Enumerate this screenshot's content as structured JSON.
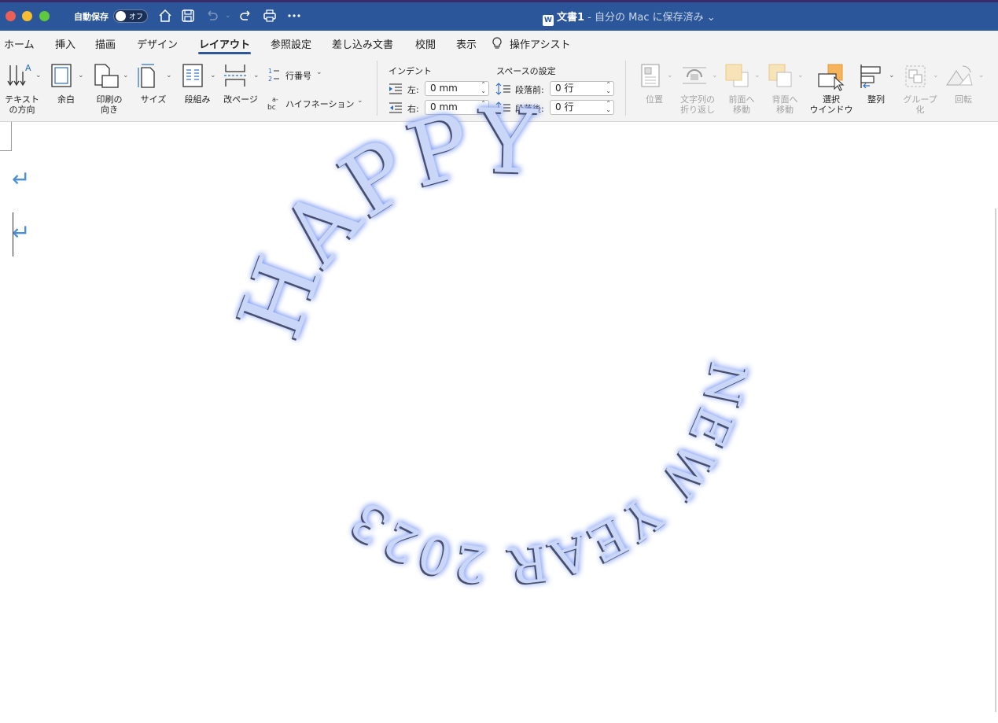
{
  "titlebar": {
    "autosave_label": "自動保存",
    "autosave_state": "オフ",
    "doc_name": "文書1",
    "doc_status": " - 自分の Mac に保存済み",
    "app_badge": "W",
    "colors": {
      "bar": "#2b579a",
      "close": "#ec5f57",
      "minimize": "#f5bd2f",
      "zoom": "#5fc83f"
    }
  },
  "tabs": [
    "ホーム",
    "挿入",
    "描画",
    "デザイン",
    "レイアウト",
    "参照設定",
    "差し込み文書",
    "校閲",
    "表示",
    "操作アシスト"
  ],
  "active_tab": "レイアウト",
  "ribbon": {
    "text_direction_line1": "テキスト",
    "text_direction_line2": "の方向",
    "margins": "余白",
    "orientation_line1": "印刷の",
    "orientation_line2": "向き",
    "size": "サイズ",
    "columns": "段組み",
    "breaks": "改ページ",
    "line_numbers": "行番号",
    "hyphenation": "ハイフネーション",
    "indent_title": "インデント",
    "indent_left_label": "左:",
    "indent_left_value": "0 mm",
    "indent_right_label": "右:",
    "indent_right_value": "0 mm",
    "spacing_title": "スペースの設定",
    "spacing_before_label": "段落前:",
    "spacing_before_value": "0 行",
    "spacing_after_label": "段落後:",
    "spacing_after_value": "0 行",
    "position": "位置",
    "wrap_line1": "文字列の",
    "wrap_line2": "折り返し",
    "bring_forward_line1": "前面へ",
    "bring_forward_line2": "移動",
    "send_backward_line1": "背面へ",
    "send_backward_line2": "移動",
    "selection_pane_line1": "選択",
    "selection_pane_line2": "ウインドウ",
    "align": "整列",
    "group_line1": "グループ",
    "group_line2": "化",
    "rotate": "回転"
  },
  "document": {
    "paragraph_mark": "↵",
    "wordart_top": "HAPPY",
    "wordart_bottom": "NEW YEAR 2023",
    "wordart_color": "#c9d6f7",
    "wordart_glow": "#7f9bf2"
  }
}
